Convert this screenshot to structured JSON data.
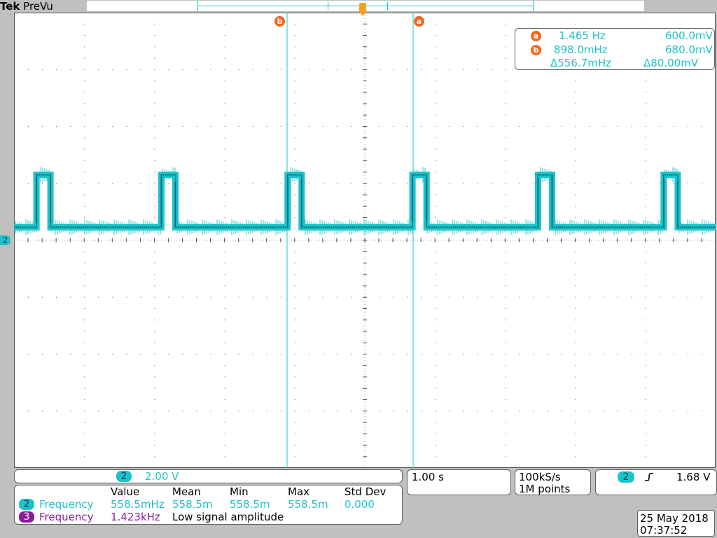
{
  "brand": {
    "tek": "Tek",
    "mode": "PreVu"
  },
  "colors": {
    "channel2": "#1cc3c9",
    "channel3": "#8c1c9a",
    "cursor": "#f2661f",
    "grid": "#000000"
  },
  "channel_marker": "2",
  "cursors": {
    "a_label": "a",
    "b_label": "b"
  },
  "cursor_readout": {
    "a": {
      "label": "a",
      "freq": "1.465 Hz",
      "volt": "600.0mV"
    },
    "b": {
      "label": "b",
      "freq": "898.0mHz",
      "volt": "680.0mV"
    },
    "delta": {
      "freq": "Δ556.7mHz",
      "volt": "Δ80.00mV"
    }
  },
  "vertical": {
    "channel": "2",
    "scale": "2.00 V"
  },
  "horizontal": {
    "scale": "1.00 s"
  },
  "acquisition": {
    "rate": "100kS/s",
    "points": "1M points"
  },
  "trigger": {
    "channel": "2",
    "slope_icon": "rising-edge-icon",
    "level": "1.68 V"
  },
  "measurements": {
    "headers": [
      "Value",
      "Mean",
      "Min",
      "Max",
      "Std Dev"
    ],
    "rows": [
      {
        "channel": "2",
        "name": "Frequency",
        "value": "558.5mHz",
        "mean": "558.5m",
        "min": "558.5m",
        "max": "558.5m",
        "stddev": "0.000"
      },
      {
        "channel": "3",
        "name": "Frequency",
        "value": "1.423kHz",
        "note": "Low signal amplitude"
      }
    ]
  },
  "datetime": {
    "date": "25 May 2018",
    "time": "07:37:52"
  },
  "waveform": {
    "pulse_starts_div": [
      0.32,
      2.1,
      3.9,
      5.68,
      7.47,
      9.26
    ],
    "pulse_width_div": 0.2,
    "high_div": -1.15,
    "low_div": -0.23
  }
}
